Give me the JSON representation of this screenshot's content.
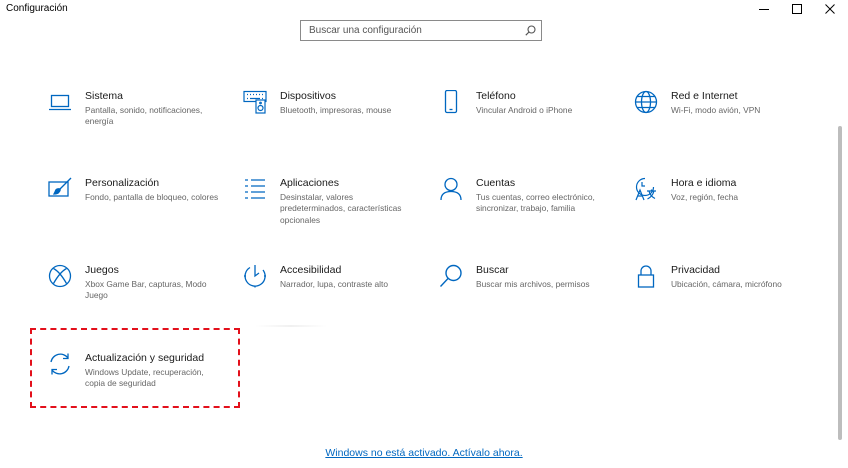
{
  "window": {
    "title": "Configuración",
    "minimize_icon": "minimize-icon",
    "maximize_icon": "maximize-icon",
    "close_icon": "close-icon"
  },
  "search": {
    "placeholder": "Buscar una configuración",
    "value": "",
    "icon": "search-icon"
  },
  "accent_color": "#0067c0",
  "highlight_color": "#e3101b",
  "tiles": [
    {
      "id": "sistema",
      "title": "Sistema",
      "desc": "Pantalla, sonido, notificaciones, energía",
      "icon": "laptop-icon"
    },
    {
      "id": "dispositivos",
      "title": "Dispositivos",
      "desc": "Bluetooth, impresoras, mouse",
      "icon": "keyboard-speaker-icon"
    },
    {
      "id": "telefono",
      "title": "Teléfono",
      "desc": "Vincular Android o iPhone",
      "icon": "phone-icon"
    },
    {
      "id": "red",
      "title": "Red e Internet",
      "desc": "Wi-Fi, modo avión, VPN",
      "icon": "globe-icon"
    },
    {
      "id": "personalizacion",
      "title": "Personalización",
      "desc": "Fondo, pantalla de bloqueo, colores",
      "icon": "paint-icon"
    },
    {
      "id": "aplicaciones",
      "title": "Aplicaciones",
      "desc": "Desinstalar, valores predeterminados, características opcionales",
      "icon": "apps-list-icon"
    },
    {
      "id": "cuentas",
      "title": "Cuentas",
      "desc": "Tus cuentas, correo electrónico, sincronizar, trabajo, familia",
      "icon": "person-icon"
    },
    {
      "id": "hora",
      "title": "Hora e idioma",
      "desc": "Voz, región, fecha",
      "icon": "time-language-icon"
    },
    {
      "id": "juegos",
      "title": "Juegos",
      "desc": "Xbox Game Bar, capturas, Modo Juego",
      "icon": "xbox-icon"
    },
    {
      "id": "accesibilidad",
      "title": "Accesibilidad",
      "desc": "Narrador, lupa, contraste alto",
      "icon": "accessibility-timer-icon"
    },
    {
      "id": "buscar",
      "title": "Buscar",
      "desc": "Buscar mis archivos, permisos",
      "icon": "magnifier-icon"
    },
    {
      "id": "privacidad",
      "title": "Privacidad",
      "desc": "Ubicación, cámara, micrófono",
      "icon": "lock-icon"
    },
    {
      "id": "actualizacion",
      "title": "Actualización y seguridad",
      "desc": "Windows Update, recuperación, copia de seguridad",
      "icon": "sync-icon"
    }
  ],
  "activation_link": "Windows no está activado. Actívalo ahora."
}
